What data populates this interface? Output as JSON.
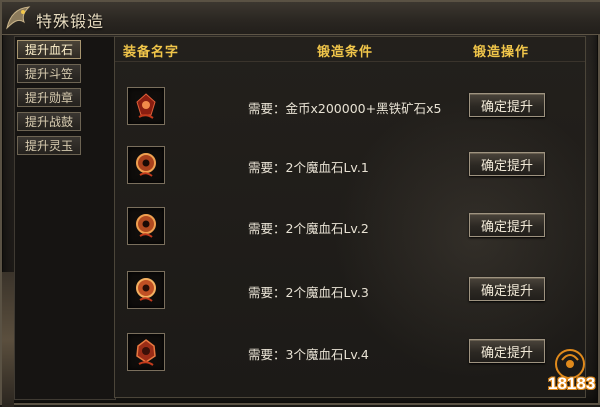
{
  "window": {
    "title": "特殊锻造"
  },
  "sidebar": {
    "tabs": [
      {
        "label": "提升血石",
        "active": true
      },
      {
        "label": "提升斗笠",
        "active": false
      },
      {
        "label": "提升勋章",
        "active": false
      },
      {
        "label": "提升战鼓",
        "active": false
      },
      {
        "label": "提升灵玉",
        "active": false
      }
    ]
  },
  "table": {
    "headers": {
      "name": "装备名字",
      "condition": "锻造条件",
      "action": "锻造操作"
    },
    "rows": [
      {
        "icon": "blood-stone-icon",
        "condition": "需要：金币x200000+黑铁矿石x5",
        "button": "确定提升"
      },
      {
        "icon": "blood-stone-icon",
        "condition": "需要：2个魔血石Lv.1",
        "button": "确定提升"
      },
      {
        "icon": "blood-stone-icon",
        "condition": "需要：2个魔血石Lv.2",
        "button": "确定提升"
      },
      {
        "icon": "blood-stone-icon",
        "condition": "需要：2个魔血石Lv.3",
        "button": "确定提升"
      },
      {
        "icon": "blood-stone-icon",
        "condition": "需要：3个魔血石Lv.4",
        "button": "确定提升"
      }
    ]
  },
  "watermark": {
    "text": "18183"
  },
  "colors": {
    "header_gold": "#f1c64a",
    "text_light": "#e8e2d4",
    "stone_red": "#c23a1c",
    "watermark_orange": "#e08a1c"
  }
}
